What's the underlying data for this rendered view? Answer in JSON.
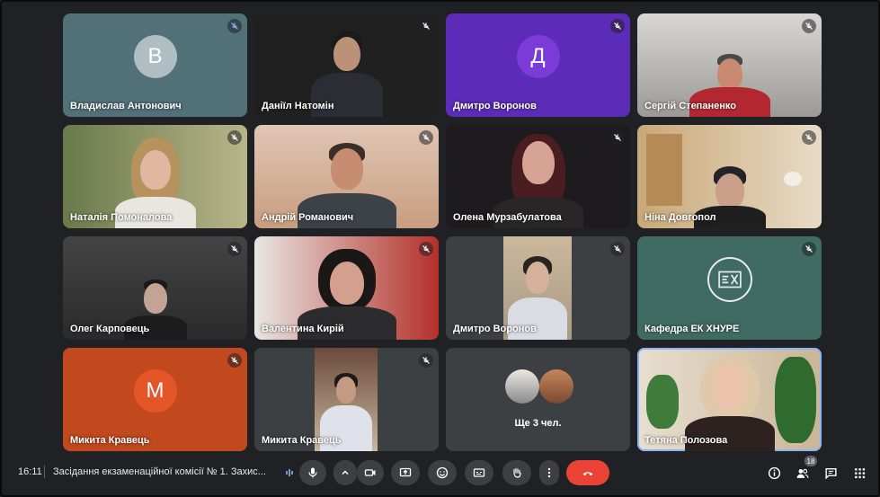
{
  "participants": [
    {
      "name": "Владислав Антонович",
      "initial": "В"
    },
    {
      "name": "Даніїл Натомін"
    },
    {
      "name": "Дмитро Воронов",
      "initial": "Д"
    },
    {
      "name": "Сергій Степаненко"
    },
    {
      "name": "Наталія Помоналова"
    },
    {
      "name": "Андрій Романович"
    },
    {
      "name": "Олена Мурзабулатова"
    },
    {
      "name": "Ніна Довгопол"
    },
    {
      "name": "Олег Карповець"
    },
    {
      "name": "Валентина Кирій"
    },
    {
      "name": "Дмитро Воронов"
    },
    {
      "name": "Кафедра ЕК ХНУРЕ"
    },
    {
      "name": "Микита Кравець",
      "initial": "М"
    },
    {
      "name": "Микита Кравець"
    },
    {
      "name": "Ще 3 чел."
    },
    {
      "name": "Тетяна Полозова"
    }
  ],
  "footer": {
    "time": "16:11",
    "meeting_title": "Засідання екзаменаційної комісії № 1. Захис...",
    "participant_count": "18"
  },
  "colors": {
    "background": "#202124",
    "end_call": "#ea4335",
    "active_speaker": "#8ab4f8"
  }
}
